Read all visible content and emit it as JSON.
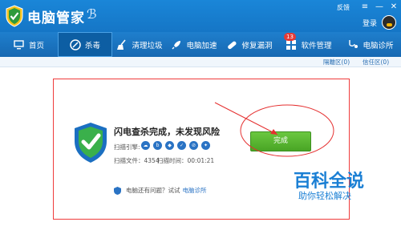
{
  "app": {
    "title": "电脑管家"
  },
  "topright": {
    "feedback": "反馈",
    "menu_icon": "menu-lines",
    "minimize": "—",
    "close": "✕"
  },
  "account": {
    "login": "登录"
  },
  "tabs": [
    {
      "label": "首页",
      "icon": "monitor-icon"
    },
    {
      "label": "杀毒",
      "icon": "kill-virus-icon"
    },
    {
      "label": "清理垃圾",
      "icon": "broom-icon"
    },
    {
      "label": "电脑加速",
      "icon": "rocket-icon"
    },
    {
      "label": "修复漏洞",
      "icon": "bandage-icon"
    },
    {
      "label": "软件管理",
      "icon": "grid-icon",
      "badge": "13"
    },
    {
      "label": "电脑诊所",
      "icon": "stethoscope-icon"
    }
  ],
  "subbar": {
    "quarantine": "隔離区(0)",
    "trust": "信任区(0)"
  },
  "result": {
    "title": "闪电查杀完成，未发现风险",
    "engine_label": "扫描引擎:",
    "files": "扫描文件：4354",
    "time": "扫描时间：00:01:21",
    "help_prefix": "电脑还有问题？试试",
    "help_link": "电脑诊所",
    "finish_button": "完成"
  },
  "watermark": {
    "big": "百科全说",
    "small": "助你轻松解决"
  },
  "colors": {
    "brand_blue": "#1576c6",
    "green": "#49a525",
    "annotation_red": "#ef3b3b"
  }
}
